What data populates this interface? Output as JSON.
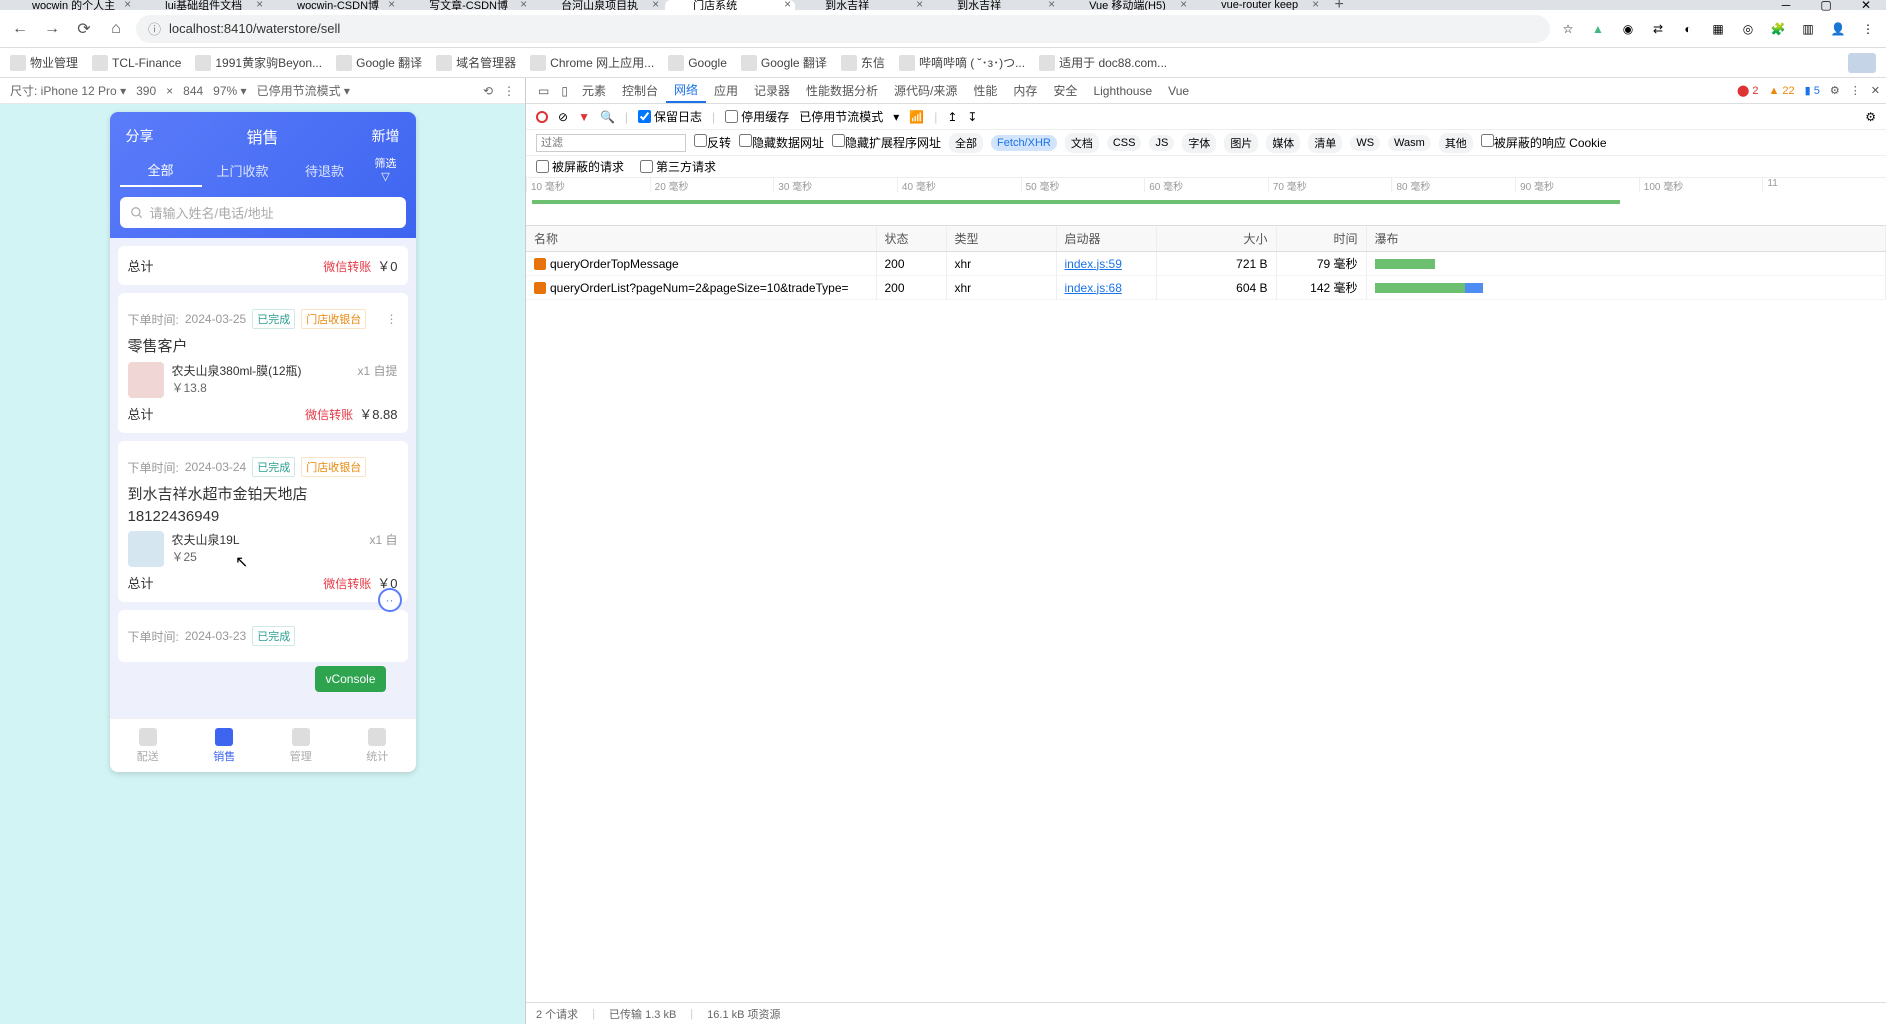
{
  "browser_tabs": [
    {
      "label": "wocwin 的个人主"
    },
    {
      "label": "lui基础组件文档"
    },
    {
      "label": "wocwin-CSDN博"
    },
    {
      "label": "写文章-CSDN博"
    },
    {
      "label": "台河山泉项目执"
    },
    {
      "label": "门店系统",
      "active": true
    },
    {
      "label": "到水吉祥"
    },
    {
      "label": "到水吉祥"
    },
    {
      "label": "Vue 移动端(H5)"
    },
    {
      "label": "vue-router keep"
    }
  ],
  "address_url": "localhost:8410/waterstore/sell",
  "bookmarks": [
    {
      "label": "物业管理"
    },
    {
      "label": "TCL-Finance"
    },
    {
      "label": "1991黄家驹Beyon..."
    },
    {
      "label": "Google 翻译"
    },
    {
      "label": "域名管理器"
    },
    {
      "label": "Chrome 网上应用..."
    },
    {
      "label": "Google"
    },
    {
      "label": "Google 翻译"
    },
    {
      "label": "东信"
    },
    {
      "label": "哔嘀哔嘀 ( ˘･з･)つ..."
    },
    {
      "label": "适用于 doc88.com..."
    }
  ],
  "device_toolbar": {
    "device": "尺寸: iPhone 12 Pro",
    "width": "390",
    "sep": "×",
    "height": "844",
    "zoom": "97%",
    "throttle": "已停用节流模式"
  },
  "phone": {
    "header": {
      "share": "分享",
      "title": "销售",
      "new": "新增"
    },
    "tabs": {
      "all": "全部",
      "door": "上门收款",
      "refund": "待退款",
      "filter": "筛选"
    },
    "search_placeholder": "请输入姓名/电话/地址",
    "orders": [
      {
        "total_label": "总计",
        "pay": "微信转账",
        "price": "￥0",
        "meta_prefix": "下单时间:",
        "meta_time": "2024-03-25",
        "tag_done": "已完成",
        "tag_pos": "门店收银台",
        "customer": "零售客户",
        "product_name": "农夫山泉380ml-膜(12瓶)",
        "product_price": "￥13.8",
        "product_qty": "x1 自提",
        "sum_label": "总计",
        "sum_pay": "微信转账",
        "sum_price": "￥8.88"
      },
      {
        "meta_prefix": "下单时间:",
        "meta_time": "2024-03-24",
        "tag_done": "已完成",
        "tag_pos": "门店收银台",
        "customer": "到水吉祥水超市金铂天地店",
        "phone": "18122436949",
        "product_name": "农夫山泉19L",
        "product_price": "￥25",
        "product_qty": "x1 自",
        "sum_label": "总计",
        "sum_pay": "微信转账",
        "sum_price": "￥0"
      },
      {
        "meta_prefix": "下单时间:",
        "meta_time": "2024-03-23",
        "tag_done": "已完成",
        "tag_pos": ""
      }
    ],
    "vconsole": "vConsole",
    "nav": [
      {
        "label": "配送"
      },
      {
        "label": "销售",
        "active": true
      },
      {
        "label": "管理"
      },
      {
        "label": "统计"
      }
    ]
  },
  "devtools": {
    "tabs": [
      "元素",
      "控制台",
      "网络",
      "应用",
      "记录器",
      "性能数据分析",
      "源代码/来源",
      "性能",
      "内存",
      "安全",
      "Lighthouse",
      "Vue"
    ],
    "active_tab": "网络",
    "badges": {
      "err": "2",
      "warn": "22",
      "info": "5"
    },
    "sub1": {
      "preserve": "保留日志",
      "disable_cache": "停用缓存",
      "throttle": "已停用节流模式"
    },
    "sub2": {
      "filter_placeholder": "过滤",
      "invert": "反转",
      "hide_data": "隐藏数据网址",
      "hide_ext": "隐藏扩展程序网址",
      "chips": [
        "全部",
        "Fetch/XHR",
        "文档",
        "CSS",
        "JS",
        "字体",
        "图片",
        "媒体",
        "清单",
        "WS",
        "Wasm",
        "其他"
      ],
      "active_chip": "Fetch/XHR",
      "blocked_cookie": "被屏蔽的响应 Cookie"
    },
    "sub3": {
      "blocked": "被屏蔽的请求",
      "third": "第三方请求"
    },
    "timeline_ticks": [
      "10 毫秒",
      "20 毫秒",
      "30 毫秒",
      "40 毫秒",
      "50 毫秒",
      "60 毫秒",
      "70 毫秒",
      "80 毫秒",
      "90 毫秒",
      "100 毫秒",
      "11"
    ],
    "table": {
      "headers": {
        "name": "名称",
        "status": "状态",
        "type": "类型",
        "initiator": "启动器",
        "size": "大小",
        "time": "时间",
        "waterfall": "瀑布"
      },
      "rows": [
        {
          "name": "queryOrderTopMessage",
          "status": "200",
          "type": "xhr",
          "initiator": "index.js:59",
          "size": "721 B",
          "time": "79 毫秒",
          "w1": 60,
          "w2": 0
        },
        {
          "name": "queryOrderList?pageNum=2&pageSize=10&tradeType=",
          "status": "200",
          "type": "xhr",
          "initiator": "index.js:68",
          "size": "604 B",
          "time": "142 毫秒",
          "w1": 90,
          "w2": 18
        }
      ]
    },
    "status": {
      "reqs": "2 个请求",
      "transfer": "已传输 1.3 kB",
      "res": "16.1 kB 项资源"
    }
  }
}
